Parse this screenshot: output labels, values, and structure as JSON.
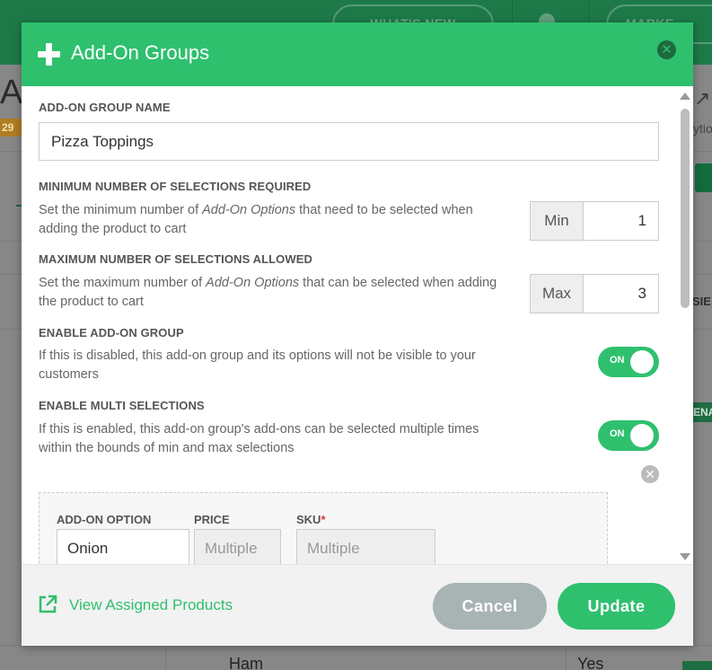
{
  "background": {
    "nav_whats_new": "WHAT'S NEW",
    "nav_market": "MARKE",
    "page_title_fragment": "Ac",
    "badge_fragment": "29",
    "options_fragment": "ytio",
    "column_fragment": "SIE",
    "status_fragment": "ENA",
    "row_item": "Ham",
    "row_value": "Yes"
  },
  "modal": {
    "title": "Add-On Groups",
    "fields": {
      "group_name_label": "ADD-ON GROUP NAME",
      "group_name_value": "Pizza Toppings",
      "min_label": "MINIMUM NUMBER OF SELECTIONS REQUIRED",
      "min_desc_1": "Set the minimum number of ",
      "min_desc_em": "Add-On Options",
      "min_desc_2": " that need to be selected when adding the product to cart",
      "min_addon": "Min",
      "min_value": "1",
      "max_label": "MAXIMUM NUMBER OF SELECTIONS ALLOWED",
      "max_desc_1": "Set the maximum number of ",
      "max_desc_em": "Add-On Options",
      "max_desc_2": " that can be selected when adding the product to cart",
      "max_addon": "Max",
      "max_value": "3",
      "enable_label": "ENABLE ADD-ON GROUP",
      "enable_desc": "If this is disabled, this add-on group and its options will not be visible to your customers",
      "enable_toggle": "ON",
      "multi_label": "ENABLE MULTI SELECTIONS",
      "multi_desc": "If this is enabled, this add-on group's add-ons can be selected multiple times within the bounds of min and max selections",
      "multi_toggle": "ON"
    },
    "option_row": {
      "option_header": "ADD-ON OPTION",
      "price_header": "PRICE",
      "sku_header": "SKU",
      "required_mark": "*",
      "option_value": "Onion",
      "price_placeholder": "Multiple",
      "sku_placeholder": "Multiple"
    },
    "footer": {
      "view_link": "View Assigned Products",
      "cancel": "Cancel",
      "update": "Update"
    }
  },
  "colors": {
    "accent": "#2fc06e",
    "cancel": "#a7b4b3"
  }
}
